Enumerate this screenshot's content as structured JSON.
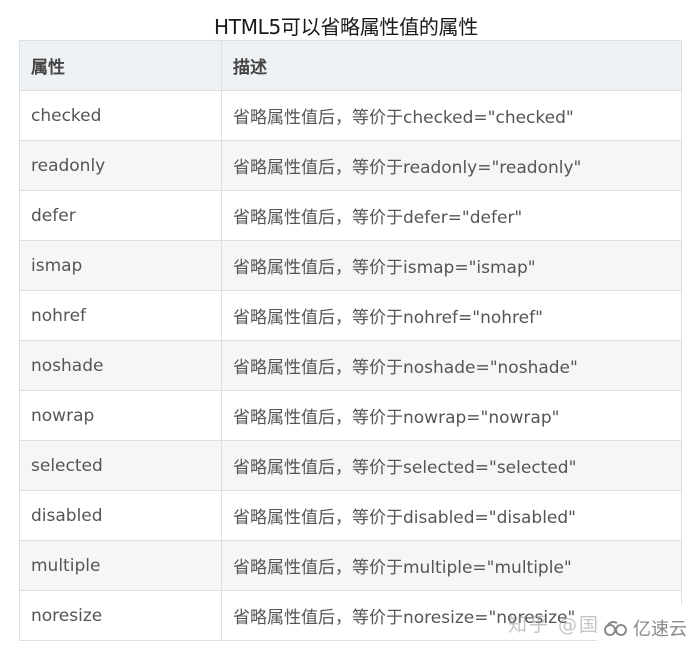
{
  "title": "HTML5可以省略属性值的属性",
  "table": {
    "headers": [
      "属性",
      "描述"
    ],
    "rows": [
      {
        "attribute": "checked",
        "description": "省略属性值后，等价于checked=\"checked\""
      },
      {
        "attribute": "readonly",
        "description": "省略属性值后，等价于readonly=\"readonly\""
      },
      {
        "attribute": "defer",
        "description": "省略属性值后，等价于defer=\"defer\""
      },
      {
        "attribute": "ismap",
        "description": "省略属性值后，等价于ismap=\"ismap\""
      },
      {
        "attribute": "nohref",
        "description": "省略属性值后，等价于nohref=\"nohref\""
      },
      {
        "attribute": "noshade",
        "description": "省略属性值后，等价于noshade=\"noshade\""
      },
      {
        "attribute": "nowrap",
        "description": "省略属性值后，等价于nowrap=\"nowrap\""
      },
      {
        "attribute": "selected",
        "description": "省略属性值后，等价于selected=\"selected\""
      },
      {
        "attribute": "disabled",
        "description": "省略属性值后，等价于disabled=\"disabled\""
      },
      {
        "attribute": "multiple",
        "description": "省略属性值后，等价于multiple=\"multiple\""
      },
      {
        "attribute": "noresize",
        "description": "省略属性值后，等价于noresize=\"noresize\""
      }
    ]
  },
  "watermarks": {
    "zhihu": "知乎 @国",
    "yisuyun": "亿速云",
    "yisuyun_icon": "cloud-logo-icon"
  }
}
